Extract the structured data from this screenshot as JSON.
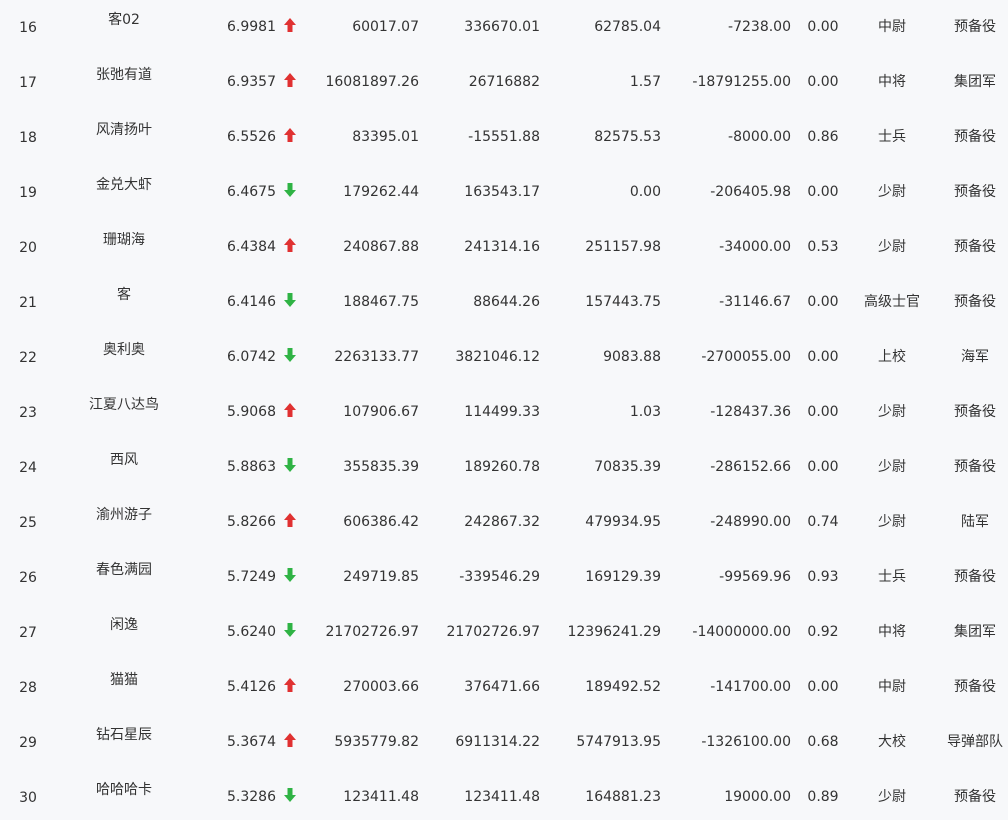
{
  "colors": {
    "up": "#e03131",
    "down": "#2fb344",
    "text": "#333333",
    "background": "#f7f8fa"
  },
  "rows": [
    {
      "rank": "16",
      "name": "客02",
      "score": "6.9981",
      "trend": "up",
      "v1": "60017.07",
      "v2": "336670.01",
      "v3": "62785.04",
      "v4": "-7238.00",
      "ratio": "0.00",
      "rank_title": "中尉",
      "branch": "预备役"
    },
    {
      "rank": "17",
      "name": "张弛有道",
      "score": "6.9357",
      "trend": "up",
      "v1": "16081897.26",
      "v2": "26716882",
      "v3": "1.57",
      "v4": "-18791255.00",
      "ratio": "0.00",
      "rank_title": "中将",
      "branch": "集团军"
    },
    {
      "rank": "18",
      "name": "风清扬叶",
      "score": "6.5526",
      "trend": "up",
      "v1": "83395.01",
      "v2": "-15551.88",
      "v3": "82575.53",
      "v4": "-8000.00",
      "ratio": "0.86",
      "rank_title": "士兵",
      "branch": "预备役"
    },
    {
      "rank": "19",
      "name": "金兑大虾",
      "score": "6.4675",
      "trend": "down",
      "v1": "179262.44",
      "v2": "163543.17",
      "v3": "0.00",
      "v4": "-206405.98",
      "ratio": "0.00",
      "rank_title": "少尉",
      "branch": "预备役"
    },
    {
      "rank": "20",
      "name": "珊瑚海",
      "score": "6.4384",
      "trend": "up",
      "v1": "240867.88",
      "v2": "241314.16",
      "v3": "251157.98",
      "v4": "-34000.00",
      "ratio": "0.53",
      "rank_title": "少尉",
      "branch": "预备役"
    },
    {
      "rank": "21",
      "name": "客",
      "score": "6.4146",
      "trend": "down",
      "v1": "188467.75",
      "v2": "88644.26",
      "v3": "157443.75",
      "v4": "-31146.67",
      "ratio": "0.00",
      "rank_title": "高级士官",
      "branch": "预备役"
    },
    {
      "rank": "22",
      "name": "奥利奥",
      "score": "6.0742",
      "trend": "down",
      "v1": "2263133.77",
      "v2": "3821046.12",
      "v3": "9083.88",
      "v4": "-2700055.00",
      "ratio": "0.00",
      "rank_title": "上校",
      "branch": "海军"
    },
    {
      "rank": "23",
      "name": "江夏八达鸟",
      "score": "5.9068",
      "trend": "up",
      "v1": "107906.67",
      "v2": "114499.33",
      "v3": "1.03",
      "v4": "-128437.36",
      "ratio": "0.00",
      "rank_title": "少尉",
      "branch": "预备役"
    },
    {
      "rank": "24",
      "name": "西风",
      "score": "5.8863",
      "trend": "down",
      "v1": "355835.39",
      "v2": "189260.78",
      "v3": "70835.39",
      "v4": "-286152.66",
      "ratio": "0.00",
      "rank_title": "少尉",
      "branch": "预备役"
    },
    {
      "rank": "25",
      "name": "渝州游子",
      "score": "5.8266",
      "trend": "up",
      "v1": "606386.42",
      "v2": "242867.32",
      "v3": "479934.95",
      "v4": "-248990.00",
      "ratio": "0.74",
      "rank_title": "少尉",
      "branch": "陆军"
    },
    {
      "rank": "26",
      "name": "春色满园",
      "score": "5.7249",
      "trend": "down",
      "v1": "249719.85",
      "v2": "-339546.29",
      "v3": "169129.39",
      "v4": "-99569.96",
      "ratio": "0.93",
      "rank_title": "士兵",
      "branch": "预备役"
    },
    {
      "rank": "27",
      "name": "闲逸",
      "score": "5.6240",
      "trend": "down",
      "v1": "21702726.97",
      "v2": "21702726.97",
      "v3": "12396241.29",
      "v4": "-14000000.00",
      "ratio": "0.92",
      "rank_title": "中将",
      "branch": "集团军"
    },
    {
      "rank": "28",
      "name": "猫猫",
      "score": "5.4126",
      "trend": "up",
      "v1": "270003.66",
      "v2": "376471.66",
      "v3": "189492.52",
      "v4": "-141700.00",
      "ratio": "0.00",
      "rank_title": "中尉",
      "branch": "预备役"
    },
    {
      "rank": "29",
      "name": "钻石星辰",
      "score": "5.3674",
      "trend": "up",
      "v1": "5935779.82",
      "v2": "6911314.22",
      "v3": "5747913.95",
      "v4": "-1326100.00",
      "ratio": "0.68",
      "rank_title": "大校",
      "branch": "导弹部队"
    },
    {
      "rank": "30",
      "name": "哈哈哈卡",
      "score": "5.3286",
      "trend": "down",
      "v1": "123411.48",
      "v2": "123411.48",
      "v3": "164881.23",
      "v4": "19000.00",
      "ratio": "0.89",
      "rank_title": "少尉",
      "branch": "预备役"
    }
  ]
}
